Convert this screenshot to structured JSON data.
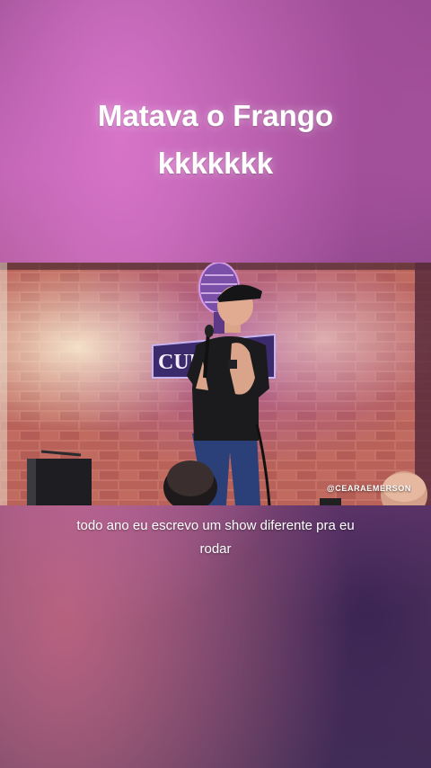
{
  "top_caption": {
    "line1": "Matava o Frango",
    "line2": "kkkkkkk"
  },
  "video": {
    "sign_text": "CUR",
    "watermark": "@CEARAEMERSON"
  },
  "subtitle": {
    "line1": "todo ano eu escrevo um show diferente pra eu",
    "line2": "rodar"
  },
  "colors": {
    "brick": "#b9675f",
    "neon": "#c873d8",
    "shirt": "#1b1b1e",
    "jeans": "#2b3f78"
  }
}
